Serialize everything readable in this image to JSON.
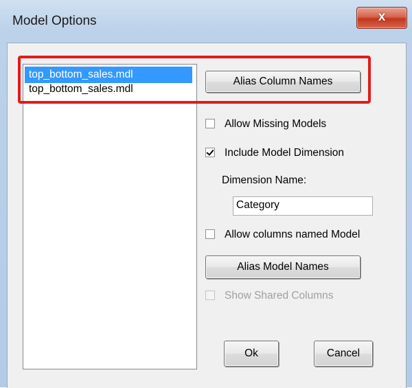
{
  "dialog": {
    "title": "Model Options",
    "close_glyph": "x"
  },
  "models_list": {
    "items": [
      {
        "label": "top_bottom_sales.mdl",
        "selected": true
      },
      {
        "label": "top_bottom_sales.mdl",
        "selected": false
      }
    ]
  },
  "buttons": {
    "alias_column_names": "Alias Column Names",
    "alias_model_names": "Alias Model Names",
    "ok": "Ok",
    "cancel": "Cancel"
  },
  "options": {
    "allow_missing_models": {
      "label": "Allow Missing Models",
      "checked": false,
      "enabled": true
    },
    "include_model_dimension": {
      "label": "Include Model Dimension",
      "checked": true,
      "enabled": true
    },
    "allow_columns_named_model": {
      "label": "Allow columns named Model",
      "checked": false,
      "enabled": true
    },
    "show_shared_columns": {
      "label": "Show Shared Columns",
      "checked": false,
      "enabled": false
    }
  },
  "dimension_name": {
    "label": "Dimension Name:",
    "value": "Category"
  },
  "colors": {
    "highlight_border": "#e21b1b",
    "selection": "#3399ff",
    "close_button": "#c2371d"
  }
}
